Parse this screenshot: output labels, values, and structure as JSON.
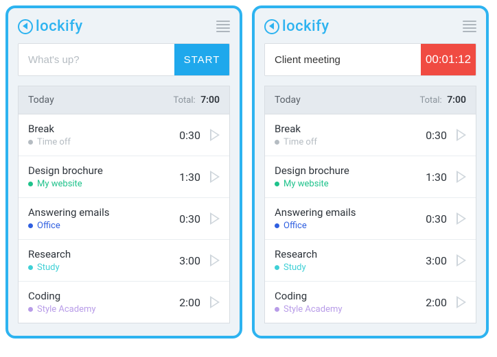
{
  "brand": "lockify",
  "panels": [
    {
      "input_value": "",
      "input_placeholder": "What's up?",
      "button_label": "START",
      "button_type": "start"
    },
    {
      "input_value": "Client meeting",
      "input_placeholder": "",
      "button_label": "00:01:12",
      "button_type": "stop"
    }
  ],
  "summary": {
    "day_label": "Today",
    "total_label": "Total:",
    "total_value": "7:00"
  },
  "entries": [
    {
      "title": "Break",
      "project": "Time off",
      "color": "#b5bcc2",
      "duration": "0:30"
    },
    {
      "title": "Design brochure",
      "project": "My website",
      "color": "#1fc28b",
      "duration": "1:30"
    },
    {
      "title": "Answering emails",
      "project": "Office",
      "color": "#2f5fe0",
      "duration": "0:30"
    },
    {
      "title": "Research",
      "project": "Study",
      "color": "#3fd0d6",
      "duration": "3:00"
    },
    {
      "title": "Coding",
      "project": "Style Academy",
      "color": "#b89ce8",
      "duration": "2:00"
    }
  ]
}
